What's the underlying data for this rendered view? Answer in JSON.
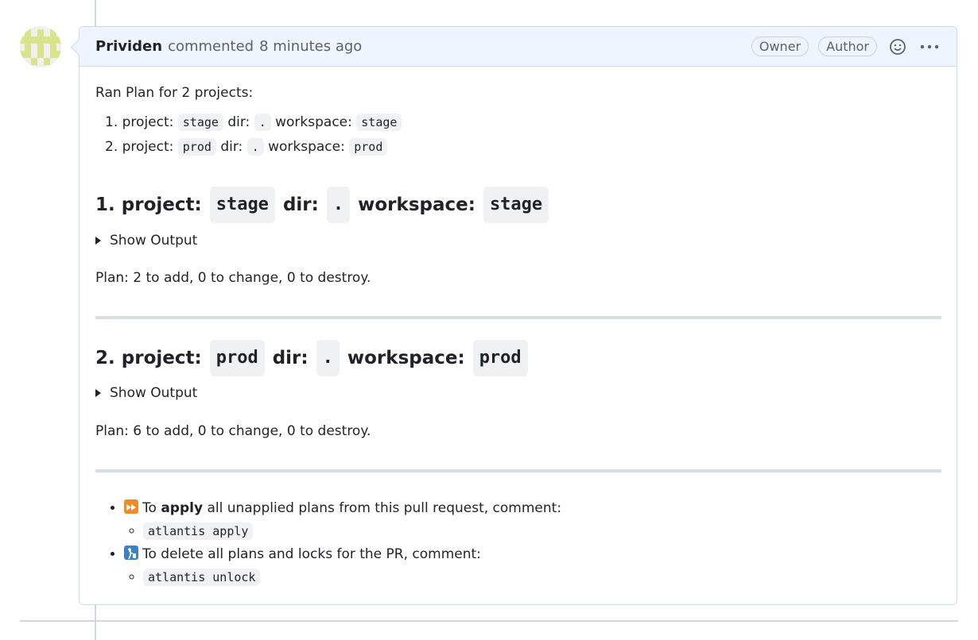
{
  "comment": {
    "author": "Prividen",
    "action": "commented",
    "time": "8 minutes ago",
    "badges": [
      "Owner",
      "Author"
    ],
    "intro": "Ran Plan for 2 projects:",
    "projects": [
      {
        "index": "1.",
        "project_label": "project:",
        "project": "stage",
        "dir_label": "dir:",
        "dir": ".",
        "workspace_label": "workspace:",
        "workspace": "stage"
      },
      {
        "index": "2.",
        "project_label": "project:",
        "project": "prod",
        "dir_label": "dir:",
        "dir": ".",
        "workspace_label": "workspace:",
        "workspace": "prod"
      }
    ],
    "sections": [
      {
        "toggle": "Show Output",
        "plan": "Plan: 2 to add, 0 to change, 0 to destroy."
      },
      {
        "toggle": "Show Output",
        "plan": "Plan: 6 to add, 0 to change, 0 to destroy."
      }
    ],
    "footer": {
      "apply": {
        "pre": "To",
        "bold": "apply",
        "post": "all unapplied plans from this pull request, comment:",
        "command": "atlantis apply",
        "emoji": "fast-forward-icon"
      },
      "unlock": {
        "text": "To delete all plans and locks for the PR, comment:",
        "command": "atlantis unlock",
        "emoji": "put-litter-icon"
      }
    }
  },
  "colors": {
    "header_bg": "#eef5fe",
    "border": "#c7def7",
    "code_bg": "#eff1f3",
    "avatar": "#d9e58a"
  }
}
